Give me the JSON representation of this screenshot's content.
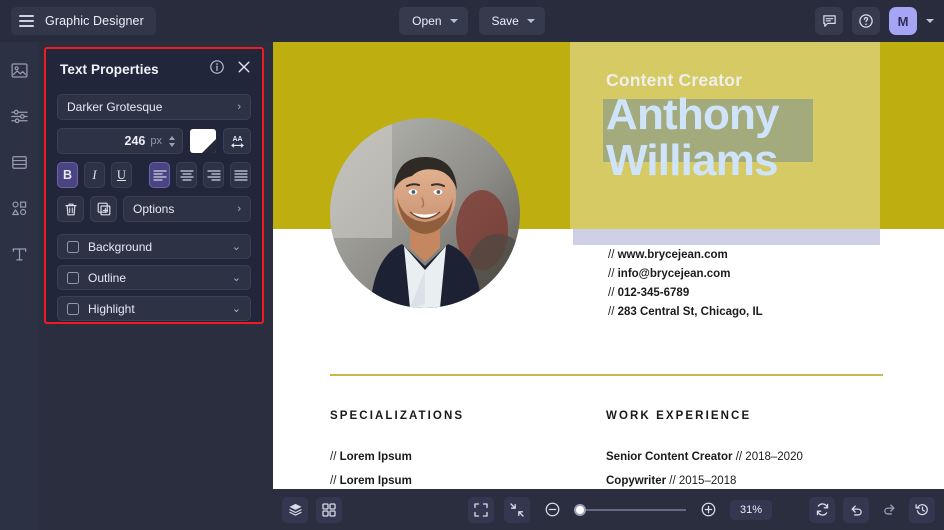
{
  "topbar": {
    "menu_icon": "hamburger-icon",
    "brand_title": "Graphic Designer",
    "open_label": "Open",
    "save_label": "Save",
    "comment_icon": "comment-icon",
    "help_icon": "help-circle-icon",
    "avatar_initial": "M",
    "avatar_color": "#a5a4f5"
  },
  "rail": {
    "items": [
      {
        "icon": "image-icon",
        "name": "sidebar-item-images"
      },
      {
        "icon": "sliders-icon",
        "name": "sidebar-item-adjustments"
      },
      {
        "icon": "layers-list-icon",
        "name": "sidebar-item-layouts"
      },
      {
        "icon": "shapes-icon",
        "name": "sidebar-item-elements"
      },
      {
        "icon": "text-icon",
        "name": "sidebar-item-text"
      }
    ]
  },
  "panel": {
    "title": "Text Properties",
    "info_icon": "info-circle-icon",
    "close_icon": "close-icon",
    "highlight_color": "#ee1c22",
    "font_family": "Darker Grotesque",
    "font_size_value": "246",
    "font_size_unit": "px",
    "color_swatch": "#ffffff",
    "letter_spacing_icon": "letter-spacing-icon",
    "bold_label": "B",
    "italic_label": "I",
    "underline_label": "U",
    "align_left_icon": "align-left-icon",
    "align_center_icon": "align-center-icon",
    "align_right_icon": "align-right-icon",
    "align_justify_icon": "align-justify-icon",
    "delete_icon": "trash-icon",
    "duplicate_icon": "duplicate-icon",
    "options_label": "Options",
    "toggles": [
      {
        "label": "Background",
        "checked": false
      },
      {
        "label": "Outline",
        "checked": false
      },
      {
        "label": "Highlight",
        "checked": false
      }
    ]
  },
  "canvas": {
    "olive_color": "#bfae10",
    "lavender_color": "#cfd0e8",
    "rule_color": "#c7b94b",
    "role": "Content Creator",
    "name_line1": "Anthony",
    "name_line2": "Williams",
    "name_color": "#cfe4fb",
    "contacts": [
      {
        "prefix": "// ",
        "bold": "www.brycejean.com",
        "rest": ""
      },
      {
        "prefix": "// ",
        "bold": "info@brycejean.com",
        "rest": ""
      },
      {
        "prefix": "// ",
        "bold": "012-345-6789",
        "rest": ""
      },
      {
        "prefix": "// ",
        "bold": "283 Central St, Chicago, IL",
        "rest": ""
      }
    ],
    "columns": [
      {
        "heading": "SPECIALIZATIONS",
        "items": [
          {
            "prefix": "// ",
            "bold": "Lorem Ipsum",
            "rest": ""
          },
          {
            "prefix": "// ",
            "bold": "Lorem Ipsum",
            "rest": ""
          }
        ]
      },
      {
        "heading": "WORK EXPERIENCE",
        "items": [
          {
            "prefix": "",
            "bold": "Senior Content Creator",
            "rest": " // 2018–2020"
          },
          {
            "prefix": "",
            "bold": "Copywriter",
            "rest": " // 2015–2018"
          }
        ]
      }
    ]
  },
  "bottombar": {
    "layers_icon": "layers-icon",
    "grid_icon": "grid-icon",
    "fit_icon": "fit-screen-icon",
    "collapse_icon": "collapse-icon",
    "zoom_out_icon": "zoom-out-icon",
    "zoom_in_icon": "zoom-in-icon",
    "zoom_value": "31%",
    "refresh_icon": "refresh-icon",
    "undo_icon": "undo-icon",
    "redo_icon": "redo-icon",
    "history_icon": "history-icon"
  }
}
